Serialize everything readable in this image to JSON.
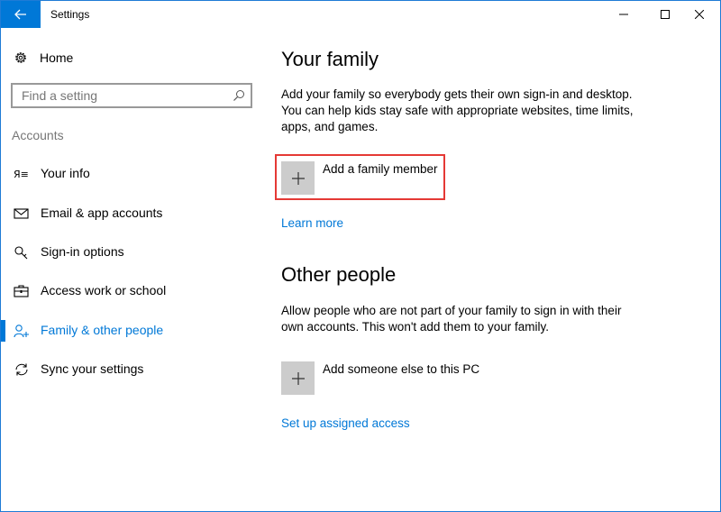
{
  "window": {
    "title": "Settings"
  },
  "sidebar": {
    "home_label": "Home",
    "search_placeholder": "Find a setting",
    "section_label": "Accounts",
    "items": [
      {
        "label": "Your info",
        "icon": "contact-card-icon"
      },
      {
        "label": "Email & app accounts",
        "icon": "mail-icon"
      },
      {
        "label": "Sign-in options",
        "icon": "key-icon"
      },
      {
        "label": "Access work or school",
        "icon": "briefcase-icon"
      },
      {
        "label": "Family & other people",
        "icon": "add-person-icon",
        "selected": true
      },
      {
        "label": "Sync your settings",
        "icon": "sync-icon"
      }
    ]
  },
  "main": {
    "family": {
      "heading": "Your family",
      "description": "Add your family so everybody gets their own sign-in and desktop. You can help kids stay safe with appropriate websites, time limits, apps, and games.",
      "add_label": "Add a family member",
      "link": "Learn more"
    },
    "other": {
      "heading": "Other people",
      "description": "Allow people who are not part of your family to sign in with their own accounts. This won't add them to your family.",
      "add_label": "Add someone else to this PC",
      "link": "Set up assigned access"
    }
  },
  "colors": {
    "accent": "#0078d7",
    "highlight_border": "#e53935",
    "tile": "#cccccc"
  }
}
